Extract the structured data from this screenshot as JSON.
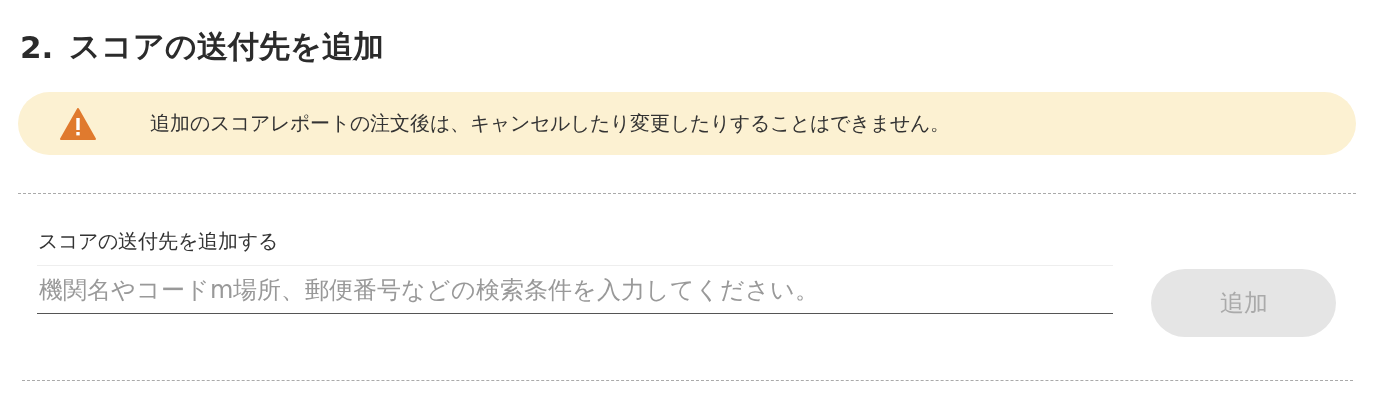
{
  "section": {
    "number": "2.",
    "title": "スコアの送付先を追加"
  },
  "notice": {
    "text": "追加のスコアレポートの注文後は、キャンセルしたり変更したりすることはできません。"
  },
  "field": {
    "label": "スコアの送付先を追加する",
    "placeholder": "機関名やコードm場所、郵便番号などの検索条件を入力してください。"
  },
  "button": {
    "label": "追加",
    "disabled": true
  }
}
